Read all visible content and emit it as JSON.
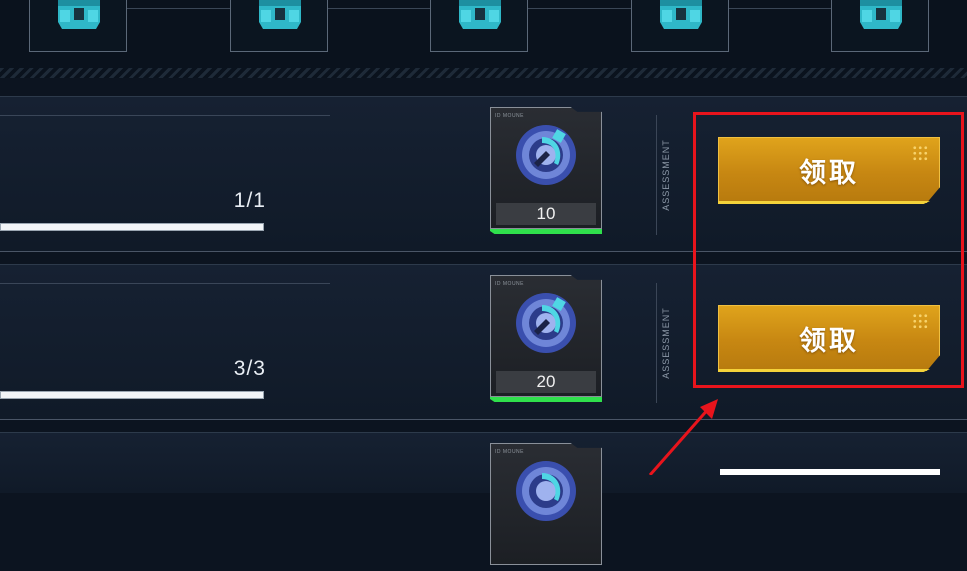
{
  "top_strip": {
    "chest_count": 5,
    "chest_icon": "treasure-chest-icon"
  },
  "tasks": [
    {
      "progress": "1/1",
      "progress_fraction": 1.0,
      "reward": {
        "icon": "coin-icon",
        "tag": "ID MOUNE",
        "quantity": "10",
        "rarity_color": "#2fe04c"
      },
      "side_label": "ASSESSMENT",
      "claim_label": "领取"
    },
    {
      "progress": "3/3",
      "progress_fraction": 1.0,
      "reward": {
        "icon": "coin-icon",
        "tag": "ID MOUNE",
        "quantity": "20",
        "rarity_color": "#2fe04c"
      },
      "side_label": "ASSESSMENT",
      "claim_label": "领取"
    },
    {
      "reward": {
        "icon": "coin-icon",
        "tag": "ID MOUNE"
      }
    }
  ],
  "annotation": {
    "box_color": "#e8141c",
    "arrow_color": "#e8141c"
  },
  "colors": {
    "accent_gold": "#d49a18",
    "rarity_green": "#2fe04c",
    "background": "#0c1420"
  }
}
